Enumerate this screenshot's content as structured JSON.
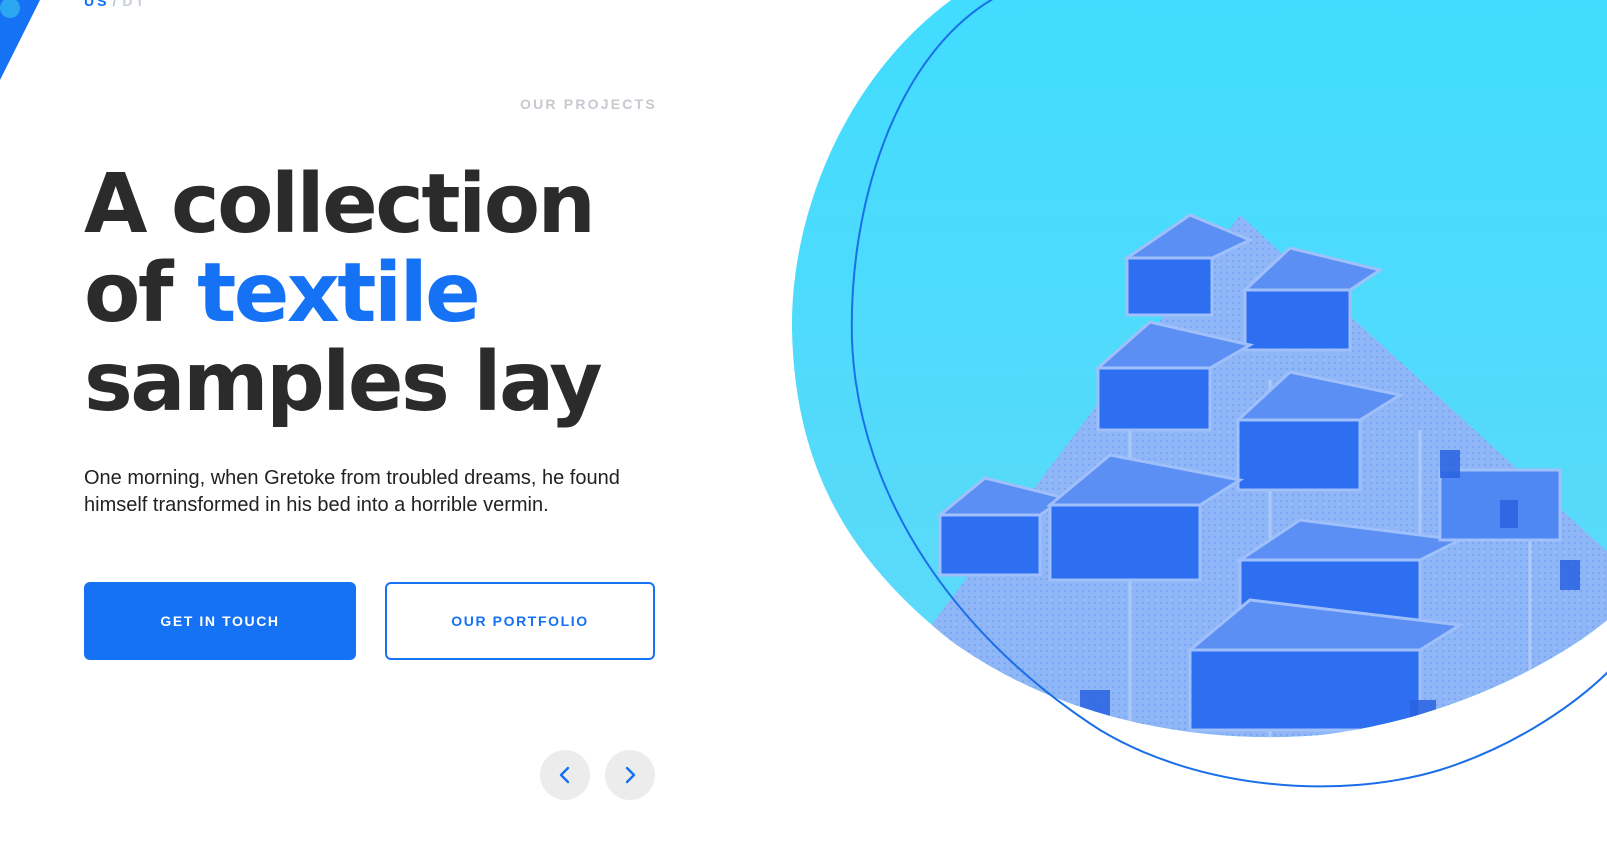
{
  "header": {
    "lang_active": "US",
    "lang_separator": "/",
    "lang_inactive": "DT"
  },
  "hero": {
    "eyebrow": "OUR PROJECTS",
    "title_line1": "A collection",
    "title_line2_prefix": "of ",
    "title_line2_accent": "textile",
    "title_line3": "samples lay",
    "description": "One morning, when Gretoke from troubled dreams, he found himself transformed in his bed into a horrible vermin.",
    "primary_button": "GET IN TOUCH",
    "secondary_button": "OUR PORTFOLIO"
  },
  "slider": {
    "prev_icon": "chevron-left-icon",
    "next_icon": "chevron-right-icon"
  },
  "colors": {
    "accent": "#1572f4",
    "heading": "#2b2b2b",
    "sky": "#45d7fb",
    "muted": "#c6c9cf"
  }
}
